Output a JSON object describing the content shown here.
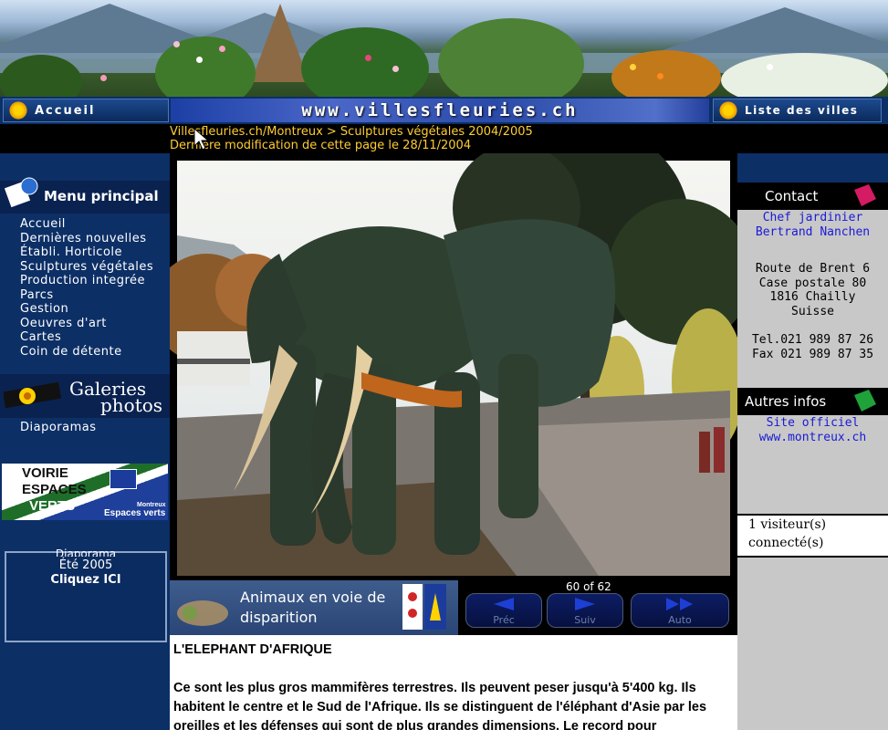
{
  "nav": {
    "home_label": "Accueil",
    "site_title": "www.villesfleuries.ch",
    "cities_label": "Liste des villes"
  },
  "breadcrumb": {
    "path": "Villesfleuries.ch/Montreux > Sculptures végétales 2004/2005",
    "modified": "Dernière modification de cette page le 28/11/2004"
  },
  "sidebar": {
    "menu_title": "Menu principal",
    "items": [
      {
        "label": "Accueil"
      },
      {
        "label": "Dernières nouvelles"
      },
      {
        "label": "Établi. Horticole"
      },
      {
        "label": "Sculptures végétales"
      },
      {
        "label": "Production integrée"
      },
      {
        "label": "Parcs"
      },
      {
        "label": "Gestion"
      },
      {
        "label": "Oeuvres d'art"
      },
      {
        "label": "Cartes"
      },
      {
        "label": "Coin de détente"
      }
    ],
    "gallery_title_1": "Galeries",
    "gallery_title_2": "photos",
    "gallery_item": "Diaporamas",
    "voirie_line1": "VOIRIE",
    "voirie_line2": "ESPACES",
    "voirie_line3": "VERTS",
    "voirie_town": "Montreux",
    "voirie_caption": "Espaces verts",
    "diapo_partial": "Diaporama",
    "diapo_season": "Été 2005",
    "diapo_cta": "Cliquez ICI"
  },
  "gallery": {
    "caption": "Animaux en voie de disparition",
    "counter": "60 of 62",
    "prev_label": "Préc",
    "next_label": "Suiv",
    "auto_label": "Auto"
  },
  "article": {
    "title": "L'ELEPHANT D'AFRIQUE",
    "body": "Ce sont les plus gros mammifères terrestres. Ils peuvent peser jusqu'à 5'400 kg. Ils habitent le centre et le Sud de l'Afrique. Ils se distinguent de l'éléphant d'Asie par les oreilles et les défenses qui sont de plus grandes dimensions. Le record pour"
  },
  "contact": {
    "header": "Contact",
    "role": "Chef jardinier",
    "name": "Bertrand Nanchen",
    "address1": "Route de Brent 6",
    "address2": "Case postale 80",
    "address3": "1816 Chailly",
    "address4": "Suisse",
    "tel": "Tel.021 989 87 26",
    "fax": "Fax 021 989 87 35"
  },
  "infos": {
    "header": "Autres infos",
    "link1": "Site officiel",
    "link2": "www.montreux.ch"
  },
  "visitors": {
    "line1": "1 visiteur(s)",
    "line2": "connecté(s)"
  },
  "colors": {
    "nav_blue": "#0c2f66",
    "crumb_orange": "#ffcc33",
    "link_blue": "#1a1ad6"
  }
}
